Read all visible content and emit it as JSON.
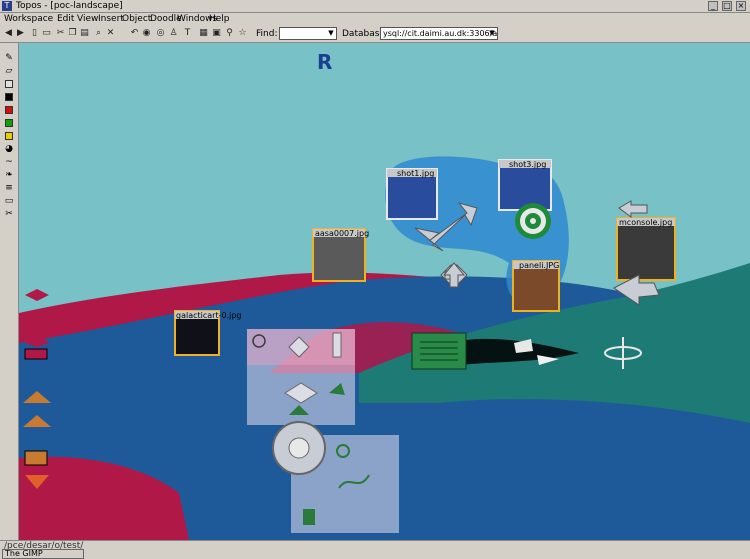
{
  "window": {
    "title": "Topos - [poc-landscape]",
    "close_glyph": "×",
    "max_glyph": "□",
    "min_glyph": "_"
  },
  "menu": [
    "Workspace",
    "Edit",
    "View",
    "Insert",
    "Object",
    "Doodle",
    "Windows",
    "Help"
  ],
  "toolbar": {
    "find_label": "Find:",
    "find_value": "",
    "database_label": "Database:",
    "database_value": "ysql://cit.daimi.au.dk:3306/aros"
  },
  "canvas": {
    "top_letter": "R",
    "photos": [
      "shot1.jpg",
      "shot3.jpg",
      "aasa0007.jpg",
      "mconsole.jpg",
      "paneli.JPG",
      "galacticart-0.jpg"
    ]
  },
  "status": {
    "path": "/pce/desar/o/test/",
    "taskbar": "The GIMP"
  },
  "colors": {
    "sky": "#78c1c6",
    "red_hill": "#b01848",
    "blue_hill": "#1e5a9a",
    "teal_hill": "#1e7a74"
  }
}
